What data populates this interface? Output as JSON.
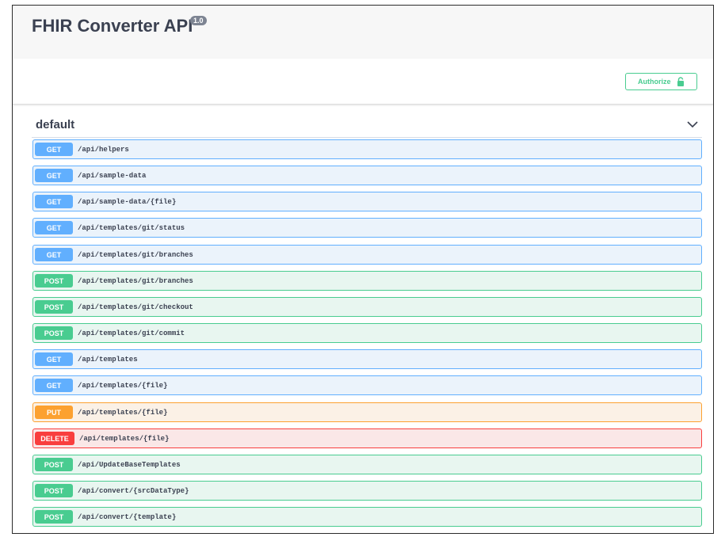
{
  "header": {
    "title": "FHIR Converter API",
    "version": "1.0"
  },
  "auth": {
    "label": "Authorize"
  },
  "tag": {
    "name": "default"
  },
  "colors": {
    "get": "#61affe",
    "post": "#49cc90",
    "put": "#fca130",
    "delete": "#f93e3e"
  },
  "operations": [
    {
      "method": "GET",
      "path": "/api/helpers"
    },
    {
      "method": "GET",
      "path": "/api/sample-data"
    },
    {
      "method": "GET",
      "path": "/api/sample-data/{file}"
    },
    {
      "method": "GET",
      "path": "/api/templates/git/status"
    },
    {
      "method": "GET",
      "path": "/api/templates/git/branches"
    },
    {
      "method": "POST",
      "path": "/api/templates/git/branches"
    },
    {
      "method": "POST",
      "path": "/api/templates/git/checkout"
    },
    {
      "method": "POST",
      "path": "/api/templates/git/commit"
    },
    {
      "method": "GET",
      "path": "/api/templates"
    },
    {
      "method": "GET",
      "path": "/api/templates/{file}"
    },
    {
      "method": "PUT",
      "path": "/api/templates/{file}"
    },
    {
      "method": "DELETE",
      "path": "/api/templates/{file}"
    },
    {
      "method": "POST",
      "path": "/api/UpdateBaseTemplates"
    },
    {
      "method": "POST",
      "path": "/api/convert/{srcDataType}"
    },
    {
      "method": "POST",
      "path": "/api/convert/{template}"
    }
  ]
}
